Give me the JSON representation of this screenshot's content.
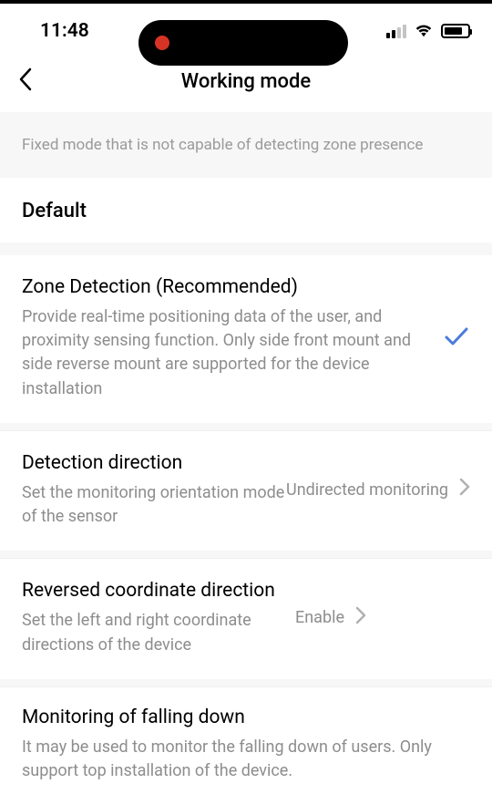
{
  "status": {
    "time": "11:48"
  },
  "header": {
    "title": "Working mode"
  },
  "banner": {
    "text": "Fixed mode that is not capable of detecting zone presence"
  },
  "sections": {
    "default_label": "Default",
    "zone": {
      "title": "Zone Detection (Recommended)",
      "desc": "Provide real-time positioning data of the user, and proximity sensing function. Only side front mount and side reverse mount are supported for the device installation"
    },
    "direction": {
      "title": "Detection direction",
      "desc": "Set the monitoring orientation mode of the sensor",
      "value": "Undirected monitoring"
    },
    "reversed": {
      "title": "Reversed coordinate direction",
      "desc": "Set the left and right coordinate directions of the device",
      "value": "Enable"
    },
    "falling": {
      "title": "Monitoring of falling down",
      "desc": "It may be used to monitor the falling down of users. Only support top installation of the device."
    }
  }
}
